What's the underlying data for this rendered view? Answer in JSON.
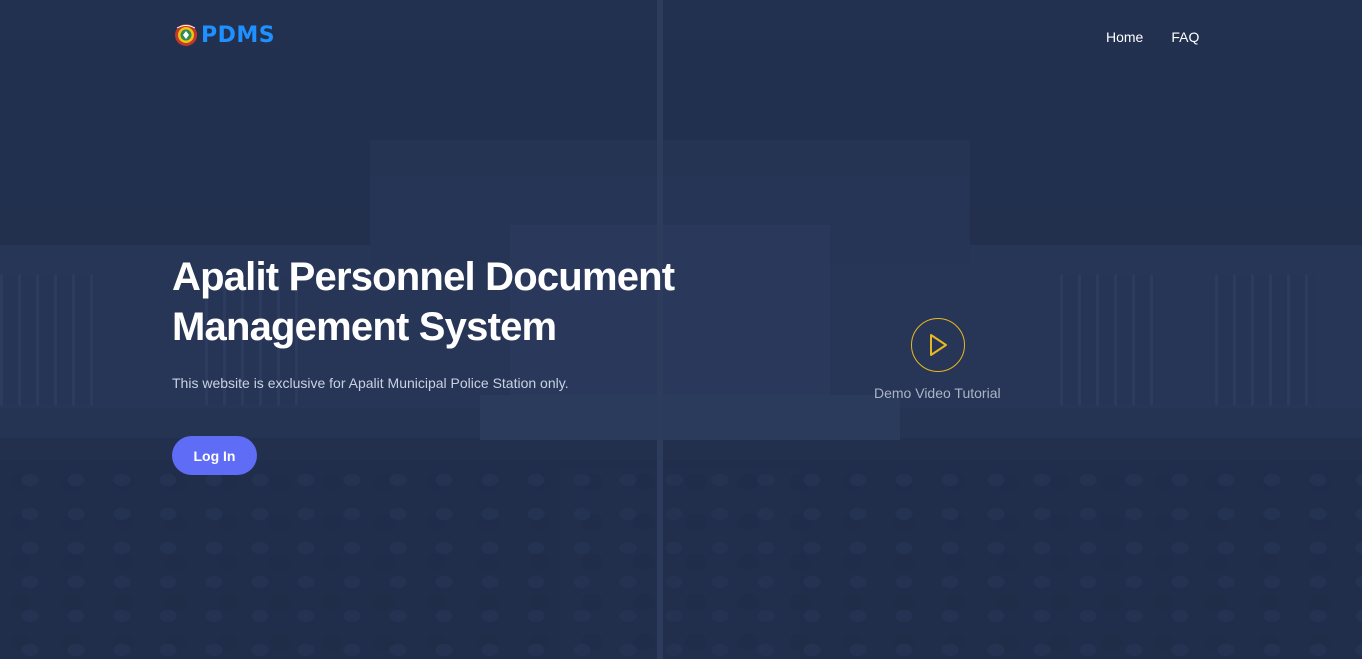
{
  "brand": {
    "name": "PDMS",
    "logo_icon": "police-seal-icon",
    "brand_color": "#1e90ff"
  },
  "nav": {
    "items": [
      {
        "label": "Home"
      },
      {
        "label": "FAQ"
      }
    ]
  },
  "hero": {
    "title": "Apalit Personnel Document Management System",
    "subtitle": "This website is exclusive for Apalit Municipal Police Station only.",
    "login_label": "Log In",
    "login_color": "#5f6cf5",
    "video_label": "Demo Video Tutorial",
    "video_icon": "play-icon",
    "video_accent": "#e9b720"
  },
  "colors": {
    "background": "#223150",
    "text": "#ffffff",
    "muted_text": "#c9d2e3"
  }
}
